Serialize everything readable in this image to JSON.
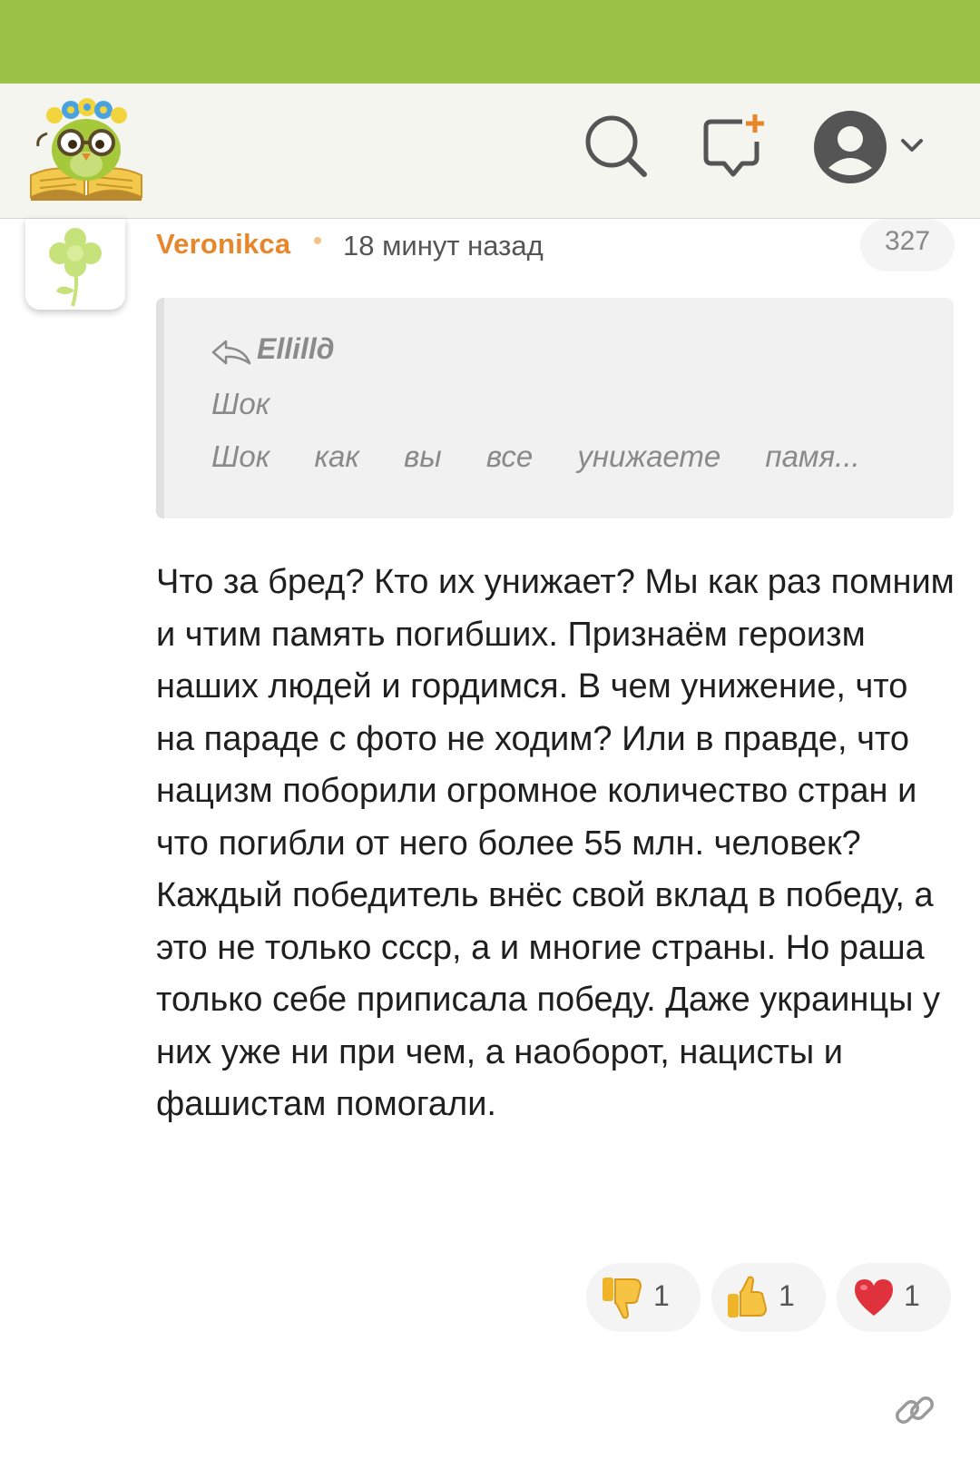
{
  "header": {
    "logo": "owl-book-logo",
    "icons": [
      "search-icon",
      "new-post-icon",
      "account-icon",
      "chevron-down-icon"
    ]
  },
  "comment": {
    "author": "Veronikca",
    "time": "18 минут назад",
    "number": "327",
    "avatar": "clover-avatar",
    "quote": {
      "author": "Ellillд",
      "line1": "Шок",
      "line2": "Шок как вы все унижаете памя..."
    },
    "body": "Что за бред? Кто их унижает? Мы как раз помним и чтим память погибших. Признаём героизм наших людей и гордимся. В чем унижение, что на параде с фото не ходим? Или в правде, что нацизм поборили огромное количество стран и что погибли от него более 55 млн. человек? Каждый победитель внёс свой вклад в победу, а это не только ссср, а и многие страны. Но раша только себе приписала победу. Даже украинцы у них уже ни при чем, а наоборот, нацисты и фашистам помогали.",
    "reactions": [
      {
        "icon": "thumbs-down-icon",
        "count": "1"
      },
      {
        "icon": "thumbs-up-icon",
        "count": "1"
      },
      {
        "icon": "heart-icon",
        "count": "1"
      }
    ]
  },
  "colors": {
    "status_bar": "#9bc146",
    "header_bg": "#f5f5f0",
    "author": "#e8862a",
    "quote_bg": "#f1f1f1"
  }
}
